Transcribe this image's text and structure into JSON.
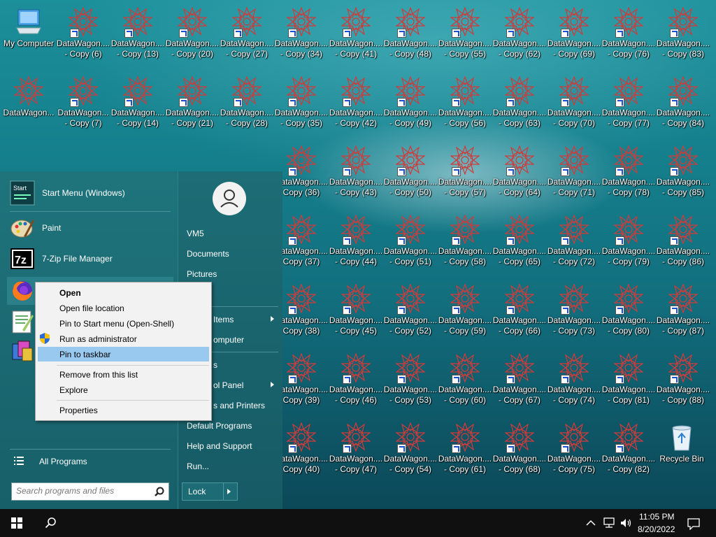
{
  "desktop": {
    "my_computer_label": "My Computer",
    "recycle_bin_label": "Recycle Bin",
    "shortcut_name": "DataWagon....",
    "shortcut_name_alt": "DataWagon...",
    "columns": [
      {
        "col": 1,
        "items": [
          "- Copy (6)",
          "- Copy (7)"
        ]
      },
      {
        "col": 2,
        "items": [
          "- Copy (13)",
          "- Copy (14)"
        ]
      },
      {
        "col": 3,
        "items": [
          "- Copy (20)",
          "- Copy (21)"
        ]
      },
      {
        "col": 4,
        "items": [
          "- Copy (27)",
          "- Copy (28)"
        ]
      },
      {
        "col": 5,
        "items": [
          "- Copy (34)",
          "- Copy (35)",
          "Copy (36)",
          "Copy (37)",
          "Copy (38)",
          "Copy (39)",
          "Copy (40)"
        ]
      },
      {
        "col": 6,
        "items": [
          "- Copy (41)",
          "- Copy (42)",
          "- Copy (43)",
          "- Copy (44)",
          "- Copy (45)",
          "- Copy (46)",
          "- Copy (47)"
        ]
      },
      {
        "col": 7,
        "items": [
          "- Copy (48)",
          "- Copy (49)",
          "- Copy (50)",
          "- Copy (51)",
          "- Copy (52)",
          "- Copy (53)",
          "- Copy (54)"
        ]
      },
      {
        "col": 8,
        "items": [
          "- Copy (55)",
          "- Copy (56)",
          "- Copy (57)",
          "- Copy (58)",
          "- Copy (59)",
          "- Copy (60)",
          "- Copy (61)"
        ]
      },
      {
        "col": 9,
        "items": [
          "- Copy (62)",
          "- Copy (63)",
          "- Copy (64)",
          "- Copy (65)",
          "- Copy (66)",
          "- Copy (67)",
          "- Copy (68)"
        ]
      },
      {
        "col": 10,
        "items": [
          "- Copy (69)",
          "- Copy (70)",
          "- Copy (71)",
          "- Copy (72)",
          "- Copy (73)",
          "- Copy (74)",
          "- Copy (75)"
        ]
      },
      {
        "col": 11,
        "items": [
          "- Copy (76)",
          "- Copy (77)",
          "- Copy (78)",
          "- Copy (79)",
          "- Copy (80)",
          "- Copy (81)",
          "- Copy (82)"
        ]
      },
      {
        "col": 12,
        "items": [
          "- Copy (83)",
          "- Copy (84)",
          "- Copy (85)",
          "- Copy (86)",
          "- Copy (87)",
          "- Copy (88)"
        ]
      }
    ]
  },
  "start_menu": {
    "programs": [
      {
        "label": "Start Menu (Windows)",
        "icon": "start-menu-icon"
      },
      {
        "label": "Paint",
        "icon": "paint-icon"
      },
      {
        "label": "7-Zip File Manager",
        "icon": "7zip-icon"
      },
      {
        "label": "",
        "icon": "firefox-icon"
      },
      {
        "label": "",
        "icon": "notepad-plus-icon"
      },
      {
        "label": "",
        "icon": "installer-icon"
      }
    ],
    "start_icon_text": "Start",
    "sevenzip_icon_text": "7z",
    "all_programs_label": "All Programs",
    "search_placeholder": "Search programs and files",
    "right_items": {
      "user": "VM5",
      "documents": "Documents",
      "pictures": "Pictures",
      "items": "Items",
      "computer": "omputer",
      "s": "s",
      "control_panel": "ol Panel",
      "printers": "s and Printers",
      "default_programs": "Default Programs",
      "help": "Help and Support",
      "run": "Run..."
    },
    "lock_label": "Lock"
  },
  "context_menu": {
    "open": "Open",
    "open_location": "Open file location",
    "pin_start": "Pin to Start menu (Open-Shell)",
    "run_admin": "Run as administrator",
    "pin_taskbar": "Pin to taskbar",
    "remove": "Remove from this list",
    "explore": "Explore",
    "properties": "Properties"
  },
  "taskbar": {
    "time": "11:05 PM",
    "date": "8/20/2022"
  }
}
